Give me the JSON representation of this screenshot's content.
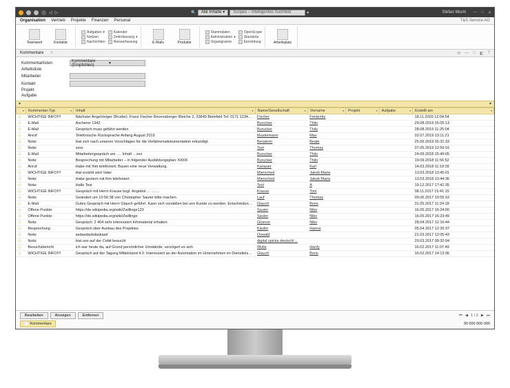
{
  "titlebar": {
    "scope_label": "Alle Inhalte",
    "search_placeholder": "Scopes – Intelligentes Suchfeld",
    "user": "Stefan Wurm"
  },
  "menubar": {
    "tabs": [
      "Organisation",
      "Vertrieb",
      "Projekte",
      "Finanzen",
      "Personal"
    ],
    "right": "T&S Service AG"
  },
  "ribbon": {
    "big": [
      {
        "label": "Teamwork"
      },
      {
        "label": "Kontakte"
      }
    ],
    "col1": [
      "Aufgaben",
      "Notizen",
      "Nachrichten"
    ],
    "col2": [
      "Kalender",
      "Zeiterfassung",
      "Reiseerfassung"
    ],
    "big2": [
      {
        "label": "E-Mails"
      },
      {
        "label": "Produkte"
      }
    ],
    "col3": [
      "Stammdaten",
      "Administration",
      "Organigramm"
    ],
    "col4": [
      "OpenScope",
      "Standorte",
      "Einrichtung"
    ],
    "big3": [
      {
        "label": "Arbeitsplatz"
      }
    ]
  },
  "subtab": {
    "label": "Kommentare"
  },
  "filters": {
    "rows": [
      {
        "label": "Kommentarlisten",
        "value": "Kommentare (Empfohlen)",
        "show": true
      },
      {
        "label": "Arbeitsliste",
        "value": "",
        "show": false
      },
      {
        "label": "Mitarbeiter",
        "value": "",
        "show": true
      },
      {
        "label": "Kontakt",
        "value": "",
        "show": true
      },
      {
        "label": "Projekt",
        "value": "",
        "show": false
      },
      {
        "label": "Aufgabe",
        "value": "",
        "show": false
      }
    ]
  },
  "columns": [
    "",
    "Kommentar-Typ",
    "Inhalt",
    "Name/Gesellschaft",
    "Vorname",
    "Projekt",
    "Aufgabe",
    "Erstellt am"
  ],
  "rows": [
    {
      "typ": "WICHTIGE INFO!!!!",
      "inhalt": "Nächster Angehöriger (Bruder): Franz Fischer Revensberger Bleiche 2, 33649 Bielefeld Tel: 0171 1234567 Mail: sebastien.batheja@…",
      "name": "Fischer",
      "vor": "Frederike",
      "proj": "",
      "auf": "",
      "dt": "18.11.2020 12:04:54"
    },
    {
      "typ": "E-Mail",
      "inhalt": "Ascherer 1342",
      "name": "Burucker",
      "vor": "Thilo",
      "proj": "",
      "auf": "",
      "dt": "29.08.2019 15:05:13"
    },
    {
      "typ": "E-Mail",
      "inhalt": "Gespräch muss geführt werden",
      "name": "Burucker",
      "vor": "Thilo",
      "proj": "",
      "auf": "",
      "dt": "28.08.2019 11:25:04"
    },
    {
      "typ": "Anruf",
      "inhalt": "Telefonische Rücksprache Anfang August 2019",
      "name": "Mustermann",
      "vor": "Max",
      "proj": "",
      "auf": "",
      "dt": "02.07.2019 13:11:21"
    },
    {
      "typ": "Notiz",
      "inhalt": "Hat sich nach unseren Vorschlägen für die Verfahrensdokumentation erkundigt.",
      "name": "Beraterin",
      "vor": "Beate",
      "proj": "",
      "auf": "",
      "dt": "25.06.2019 15:31:33"
    },
    {
      "typ": "Notiz",
      "inhalt": "xxxx",
      "name": "Test",
      "vor": "Thomas",
      "proj": "",
      "auf": "",
      "dt": "07.05.2019 12:59:16"
    },
    {
      "typ": "E-Mail",
      "inhalt": "Mitarbeitergespräch am …. Inhalt …xxx",
      "name": "Burucker",
      "vor": "Thilo",
      "proj": "",
      "auf": "",
      "dt": "24.09.2018 15:49:05"
    },
    {
      "typ": "Notiz",
      "inhalt": "Besprechung mit Mitarbeiter – in folgender Ausbildungsplan: KKKK",
      "name": "Burucker",
      "vor": "Thilo",
      "proj": "",
      "auf": "",
      "dt": "19.09.2018 11:56:52"
    },
    {
      "typ": "Anruf",
      "inhalt": "Habe mit Ihm telefoniert. Bauen eine neue Verwaltung.",
      "name": "Kanauer",
      "vor": "Karl",
      "proj": "",
      "auf": "",
      "dt": "14.03.2018 11:19:39"
    },
    {
      "typ": "WICHTIGE INFO!!!!",
      "inhalt": "Hat erzählt wird Vater",
      "name": "Miersched",
      "vor": "Jakob Maria",
      "proj": "",
      "auf": "",
      "dt": "13.03.2018 13:45:01"
    },
    {
      "typ": "Notiz",
      "inhalt": "Habe gestern mit ihm telefoniert",
      "name": "Miersched",
      "vor": "Jakob Maria",
      "proj": "",
      "auf": "",
      "dt": "13.03.2018 13:44:36"
    },
    {
      "typ": "Notiz",
      "inhalt": "Hallo Test",
      "name": "Test",
      "vor": "A",
      "proj": "",
      "auf": "",
      "dt": "19.12.2017 17:41:35"
    },
    {
      "typ": "WICHTIGE INFO!!!!",
      "inhalt": "Gespräch mit Herrn Krause bzgl. Angebot … ……",
      "name": "Krause",
      "vor": "Tom",
      "proj": "",
      "auf": "",
      "dt": "08.11.2017 15:41:15"
    },
    {
      "typ": "Notiz",
      "inhalt": "Geändert um 10:56:38 von Christopher Sauter  bitte machen",
      "name": "Lauf",
      "vor": "Thomas",
      "proj": "",
      "auf": "",
      "dt": "09.06.2017 10:55:10"
    },
    {
      "typ": "E-Mail",
      "inhalt": "Gutes Gespräch mit Herrn Glauch geführt. Kann sich vorstellen bei uns Kunde zu werden. Entscheidung nächsten Monat",
      "name": "Glauch",
      "vor": "Boris",
      "proj": "",
      "auf": "",
      "dt": "31.05.2017 11:24:18"
    },
    {
      "typ": "Offene Punkte",
      "inhalt": "https://de.wikipedia.org/wiki/Zwillinge123",
      "name": "Sauter",
      "vor": "Niko",
      "proj": "",
      "auf": "",
      "dt": "16.05.2017 16:24:00"
    },
    {
      "typ": "Offene Punkte",
      "inhalt": "https://de.wikipedia.org/wiki/Zwillinge",
      "name": "Sauter",
      "vor": "Niko",
      "proj": "",
      "auf": "",
      "dt": "16.05.2017 16:23:49"
    },
    {
      "typ": "Notiz",
      "inhalt": "Gespräch:  2 404  sehr interessiert Infomaterial erhalten",
      "name": "Gluever",
      "vor": "Niko",
      "proj": "",
      "auf": "",
      "dt": "28.04.2017 12:16:44"
    },
    {
      "typ": "Besprechung",
      "inhalt": "Gespräch über Ausbau des Projektes",
      "name": "Käufer",
      "vor": "Hanna",
      "proj": "",
      "auf": "",
      "dt": "05.04.2017 12:26:37"
    },
    {
      "typ": "Notiz",
      "inhalt": "asdasdaskdaskasd",
      "name": "Oswald",
      "vor": "",
      "proj": "",
      "auf": "",
      "dt": "21.03.2017 12:05:43"
    },
    {
      "typ": "Notiz",
      "inhalt": "Hat uns auf der Cebit besucht",
      "name": "digital spicka deutschl…",
      "vor": "",
      "proj": "",
      "auf": "",
      "dt": "20.03.2017 09:32:04"
    },
    {
      "typ": "Besuchsbericht",
      "inhalt": "ich war heute da, auf Grund persönlicher Umstände, verzögert es sich",
      "name": "Wulle",
      "vor": "Hardy",
      "proj": "",
      "auf": "",
      "dt": "16.02.2017 11:07:49"
    },
    {
      "typ": "WICHTIGE INFO!!!!",
      "inhalt": "Gespräch auf der Tagung Mittelstand 4.0. Interessiert an der Automation im Unternehmen im Dienstleistungssektor. Weiterhin fünf…",
      "name": "Glauch",
      "vor": "Boris",
      "proj": "",
      "auf": "",
      "dt": "16.02.2017 14:13:36"
    }
  ],
  "footer": {
    "buttons": [
      "Bearbeiten",
      "Anzeigen",
      "Entfernen"
    ],
    "pager": "1 / 2",
    "tab": "Kommentare",
    "count": "30 000 000 000"
  }
}
